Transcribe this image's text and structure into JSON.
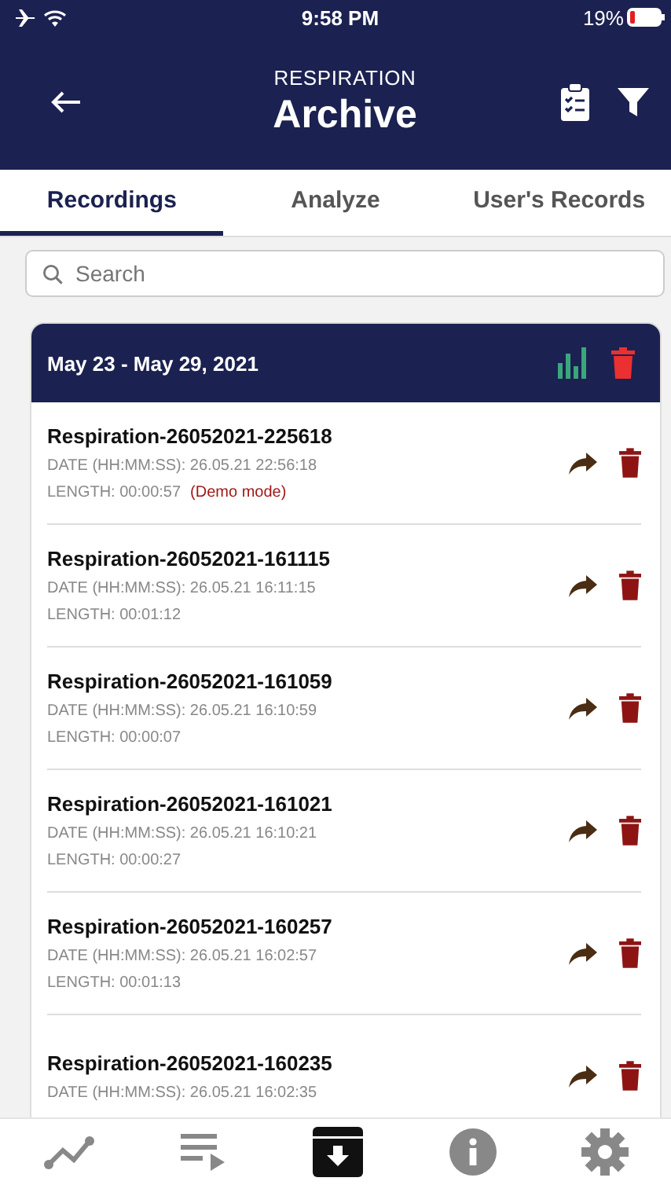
{
  "status_bar": {
    "time": "9:58 PM",
    "battery": "19%"
  },
  "header": {
    "subtitle": "RESPIRATION",
    "title": "Archive"
  },
  "tabs": [
    {
      "label": "Recordings",
      "selected": true
    },
    {
      "label": "Analyze",
      "selected": false
    },
    {
      "label": "User's Records",
      "selected": false
    }
  ],
  "search": {
    "placeholder": "Search"
  },
  "group": {
    "title": "May 23 - May 29, 2021"
  },
  "recordings": [
    {
      "name": "Respiration-26052021-225618",
      "date": "DATE (HH:MM:SS): 26.05.21 22:56:18",
      "length": "LENGTH: 00:00:57",
      "note": "(Demo mode)"
    },
    {
      "name": "Respiration-26052021-161115",
      "date": "DATE (HH:MM:SS): 26.05.21 16:11:15",
      "length": "LENGTH: 00:01:12"
    },
    {
      "name": "Respiration-26052021-161059",
      "date": "DATE (HH:MM:SS): 26.05.21 16:10:59",
      "length": "LENGTH: 00:00:07"
    },
    {
      "name": "Respiration-26052021-161021",
      "date": "DATE (HH:MM:SS): 26.05.21 16:10:21",
      "length": "LENGTH: 00:00:27"
    },
    {
      "name": "Respiration-26052021-160257",
      "date": "DATE (HH:MM:SS): 26.05.21 16:02:57",
      "length": "LENGTH: 00:01:13"
    },
    {
      "name": "Respiration-26052021-160235",
      "date": "DATE (HH:MM:SS): 26.05.21 16:02:35"
    }
  ],
  "bottom_nav": [
    {
      "kind": "chart",
      "selected": false
    },
    {
      "kind": "playlist",
      "selected": false
    },
    {
      "kind": "archive",
      "selected": true
    },
    {
      "kind": "info",
      "selected": false
    },
    {
      "kind": "settings",
      "selected": false
    }
  ]
}
